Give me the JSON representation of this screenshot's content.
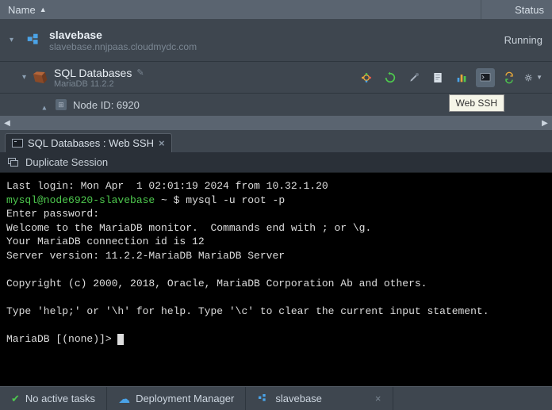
{
  "header": {
    "name": "Name",
    "status": "Status"
  },
  "env": {
    "title": "slavebase",
    "subtitle": "slavebase.nnjpaas.cloudmydc.com",
    "status": "Running"
  },
  "node": {
    "title": "SQL Databases",
    "subtitle": "MariaDB 11.2.2"
  },
  "subnode": {
    "title": "Node ID: 6920"
  },
  "tooltip": "Web SSH",
  "tab": {
    "title": "SQL Databases : Web SSH"
  },
  "actionbar": {
    "duplicate": "Duplicate Session"
  },
  "terminal": {
    "lastlogin": "Last login: Mon Apr  1 02:01:19 2024 from 10.32.1.20",
    "prompt_user": "mysql@node6920-slavebase",
    "prompt_path": "~",
    "command": "mysql -u root -p",
    "enter_pw": "Enter password:",
    "welcome": "Welcome to the MariaDB monitor.  Commands end with ; or \\g.",
    "conn": "Your MariaDB connection id is 12",
    "version": "Server version: 11.2.2-MariaDB MariaDB Server",
    "copyright": "Copyright (c) 2000, 2018, Oracle, MariaDB Corporation Ab and others.",
    "help": "Type 'help;' or '\\h' for help. Type '\\c' to clear the current input statement.",
    "db_prompt": "MariaDB [(none)]> "
  },
  "footer": {
    "tasks": "No active tasks",
    "deploy": "Deployment Manager",
    "env": "slavebase"
  }
}
